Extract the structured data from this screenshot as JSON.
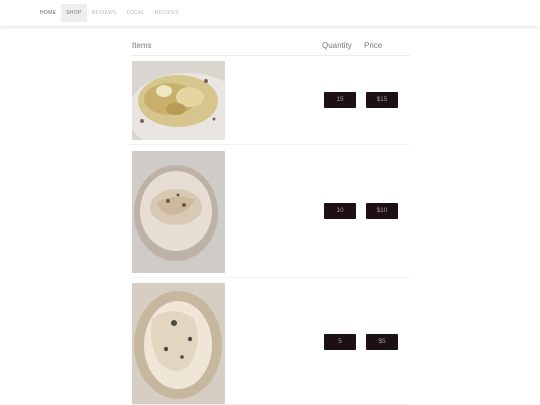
{
  "nav": {
    "items": [
      {
        "label": "HOME"
      },
      {
        "label": "SHOP"
      },
      {
        "label": "REVIEWS"
      },
      {
        "label": "LOCAL"
      },
      {
        "label": "RECIPES"
      }
    ]
  },
  "table": {
    "headers": {
      "items": "Items",
      "quantity": "Quantity",
      "price": "Price"
    },
    "rows": [
      {
        "image": "food-bowl-image",
        "quantity": "15",
        "price": "$15"
      },
      {
        "image": "food-bowl-image",
        "quantity": "10",
        "price": "$10"
      },
      {
        "image": "food-bowl-image",
        "quantity": "5",
        "price": "$5"
      }
    ]
  },
  "colors": {
    "pill_bg": "#1d0f16",
    "pill_text": "#a89aa0",
    "nav_active_bg": "#eeeeee"
  }
}
